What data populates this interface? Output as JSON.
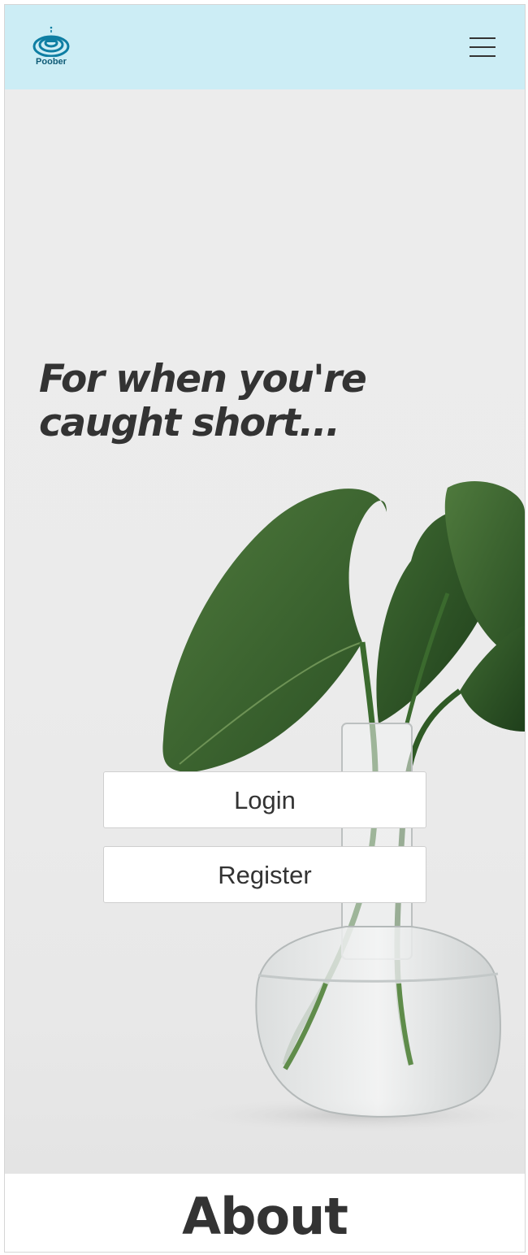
{
  "header": {
    "brand_name": "Poober",
    "logo_icon": "water-drop-ripple-icon",
    "menu_icon": "hamburger-menu-icon",
    "colors": {
      "background": "#ccedf5",
      "logo": "#0e7ea3"
    }
  },
  "hero": {
    "tagline": "For when you're caught short...",
    "image": "plant-in-glass-vase",
    "login_label": "Login",
    "register_label": "Register"
  },
  "about": {
    "heading": "About"
  }
}
